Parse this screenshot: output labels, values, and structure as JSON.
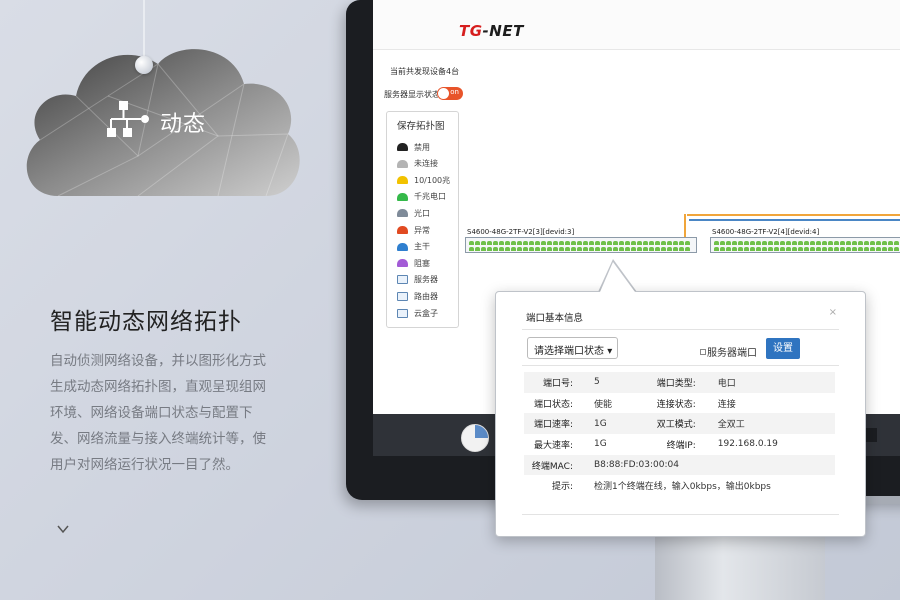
{
  "hero": {
    "badge_label": "动态",
    "title": "智能动态网络拓扑",
    "description": "自动侦测网络设备，并以图形化方式生成动态网络拓扑图，直观呈现组网环境、网络设备端口状态与配置下发、网络流量与接入终端统计等，使用户对网络运行状况一目了然。"
  },
  "app": {
    "logo_prefix": "TG",
    "logo_suffix": "-NET",
    "device_count": "当前共发现设备4台",
    "server_display_label": "服务器显示状态",
    "toggle_text": "on"
  },
  "legend": {
    "title": "保存拓扑图",
    "items": [
      {
        "label": "禁用",
        "color": "#222222"
      },
      {
        "label": "未连接",
        "color": "#b4b4b4"
      },
      {
        "label": "10/100兆",
        "color": "#f2c200"
      },
      {
        "label": "千兆电口",
        "color": "#35b94a"
      },
      {
        "label": "光口",
        "color": "#7f8b99"
      },
      {
        "label": "异常",
        "color": "#e14a21"
      },
      {
        "label": "主干",
        "color": "#2f7fcf"
      },
      {
        "label": "阻塞",
        "color": "#a35bd6"
      },
      {
        "label": "服务器",
        "color": "#5d86b3"
      },
      {
        "label": "路由器",
        "color": "#5d86b3"
      },
      {
        "label": "云盒子",
        "color": "#5d86b3"
      }
    ]
  },
  "switches": [
    {
      "label": "S4600-48G-2TF-V2[3][devid:3]"
    },
    {
      "label": "S4600-48G-2TF-V2[4][devid:4]"
    }
  ],
  "popup": {
    "title": "端口基本信息",
    "close": "×",
    "select_value": "请选择端口状态",
    "server_port_label": "服务器端口",
    "set_button": "设置",
    "rows": [
      {
        "k1": "端口号:",
        "v1": "5",
        "k2": "端口类型:",
        "v2": "电口"
      },
      {
        "k1": "端口状态:",
        "v1": "使能",
        "k2": "连接状态:",
        "v2": "连接"
      },
      {
        "k1": "端口速率:",
        "v1": "1G",
        "k2": "双工模式:",
        "v2": "全双工"
      },
      {
        "k1": "最大速率:",
        "v1": "1G",
        "k2": "终端IP:",
        "v2": "192.168.0.19"
      }
    ],
    "mac_label": "终端MAC:",
    "mac_value": "B8:88:FD:03:00:04",
    "tip_label": "提示:",
    "tip_value": "检测1个终端在线，输入0kbps，输出0kbps"
  }
}
